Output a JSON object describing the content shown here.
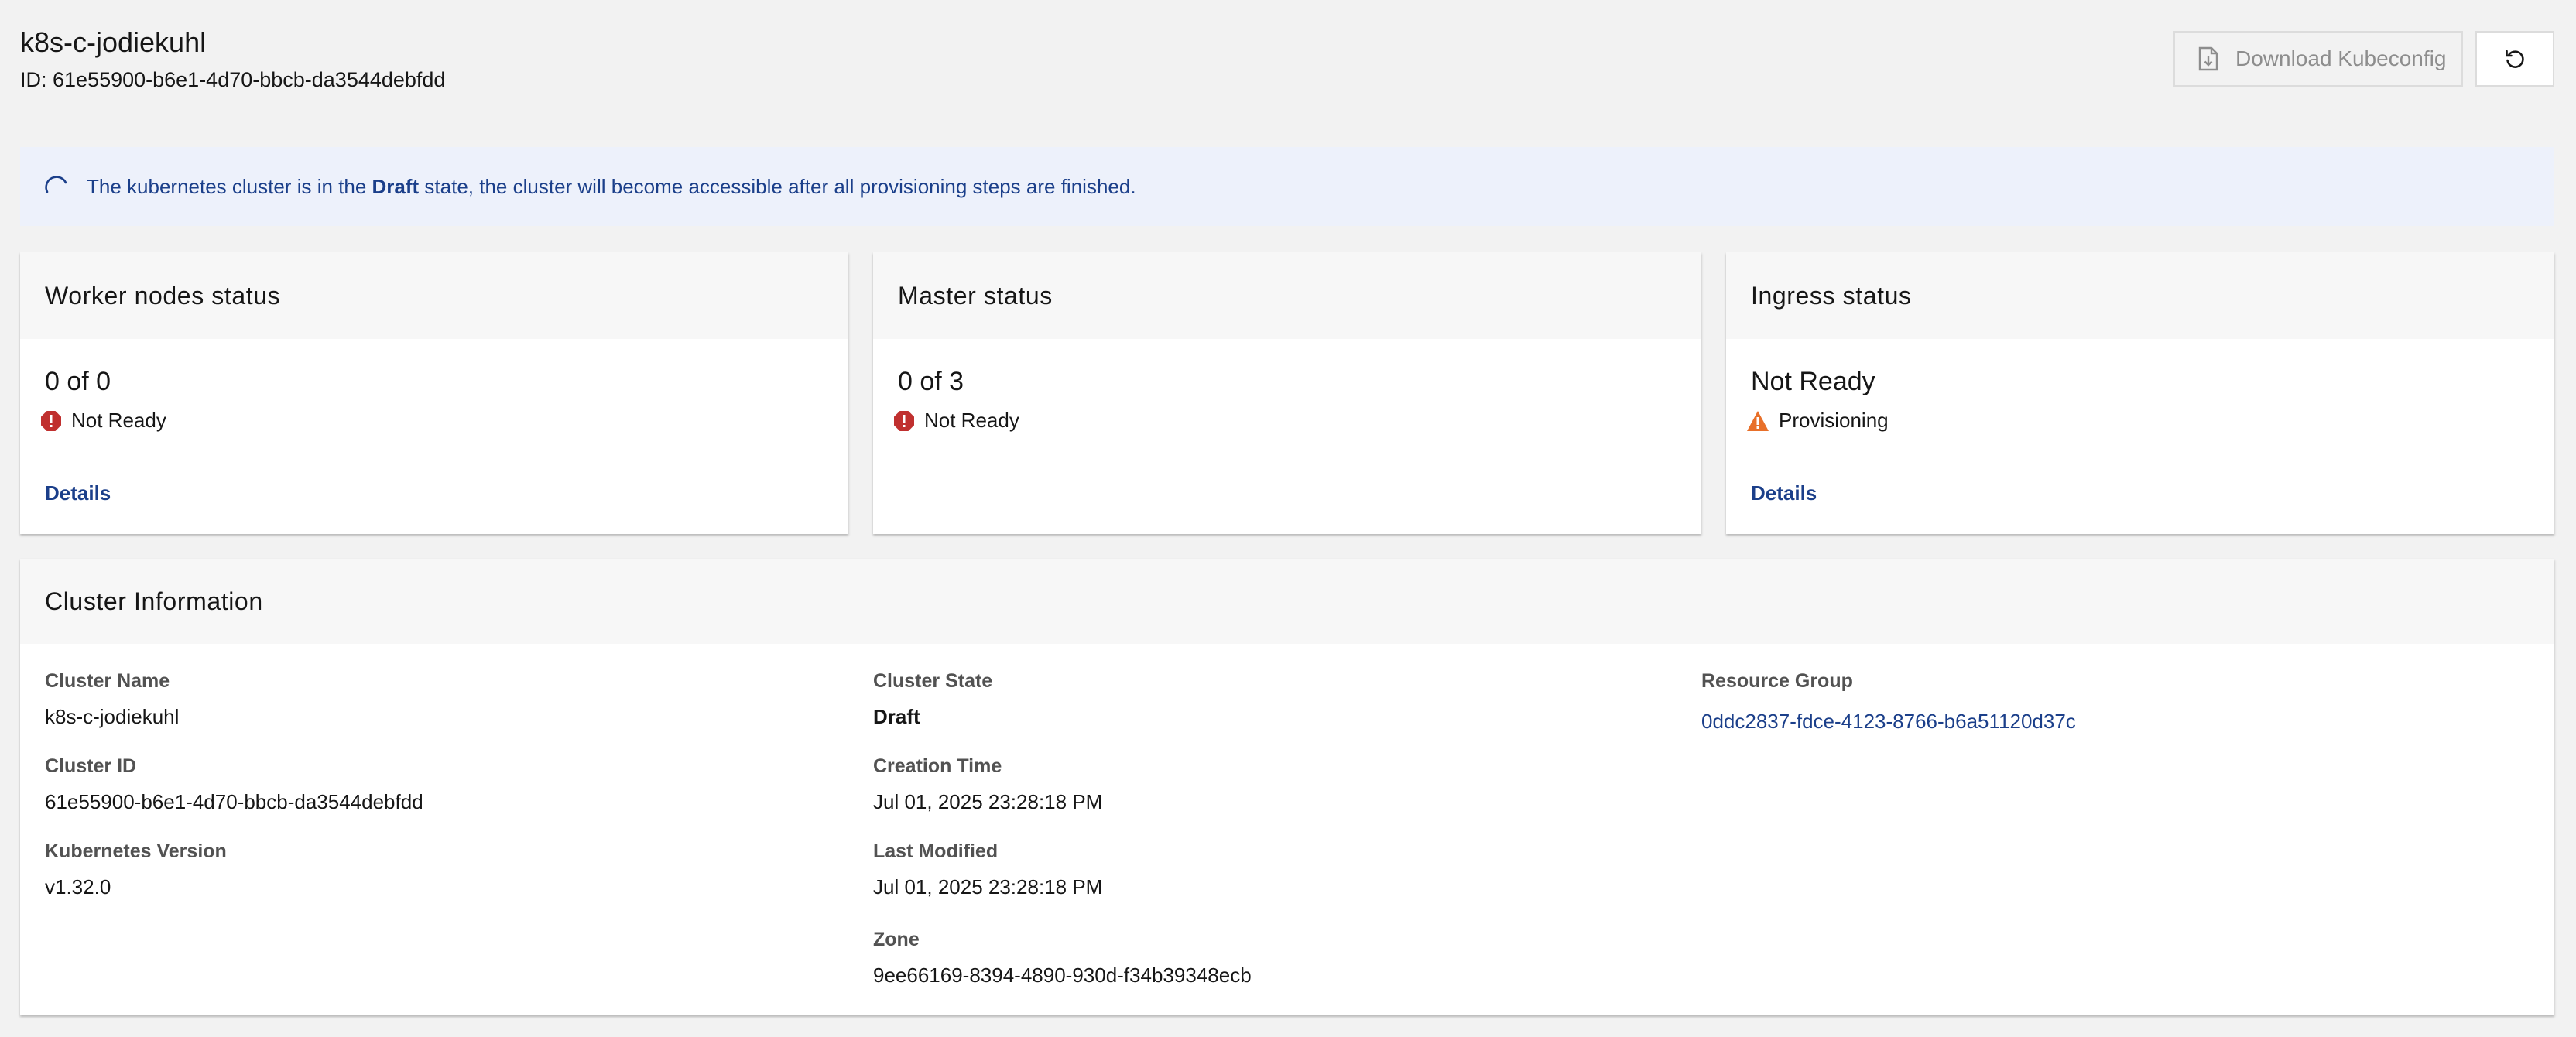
{
  "header": {
    "title": "k8s-c-jodiekuhl",
    "subtitle": "ID: 61e55900-b6e1-4d70-bbcb-da3544debfdd",
    "download_label": "Download Kubeconfig"
  },
  "banner": {
    "text_before": "The kubernetes cluster is in the ",
    "state": "Draft",
    "text_after": " state, the cluster will become accessible after all provisioning steps are finished."
  },
  "cards": {
    "workers": {
      "title": "Worker nodes status",
      "count": "0 of 0",
      "state": "Not Ready",
      "link": "Details"
    },
    "master": {
      "title": "Master status",
      "count": "0 of 3",
      "state": "Not Ready"
    },
    "ingress": {
      "title": "Ingress status",
      "count": "Not Ready",
      "state": "Provisioning",
      "link": "Details"
    }
  },
  "info": {
    "title": "Cluster Information",
    "cluster_name": {
      "label": "Cluster Name",
      "value": "k8s-c-jodiekuhl"
    },
    "cluster_id": {
      "label": "Cluster ID",
      "value": "61e55900-b6e1-4d70-bbcb-da3544debfdd"
    },
    "k8s_version": {
      "label": "Kubernetes Version",
      "value": "v1.32.0"
    },
    "cluster_state": {
      "label": "Cluster State",
      "value": "Draft"
    },
    "creation_time": {
      "label": "Creation Time",
      "value": "Jul 01, 2025 23:28:18 PM"
    },
    "last_modified": {
      "label": "Last Modified",
      "value": "Jul 01, 2025 23:28:18 PM"
    },
    "zone": {
      "label": "Zone",
      "value": "9ee66169-8394-4890-930d-f34b39348ecb"
    },
    "resource_group": {
      "label": "Resource Group",
      "value": "0ddc2837-fdce-4123-8766-b6a51120d37c"
    }
  },
  "colors": {
    "link": "#1b3f8a",
    "error": "#c0302f",
    "warning": "#e8702a",
    "banner_bg": "#edf1fb"
  }
}
